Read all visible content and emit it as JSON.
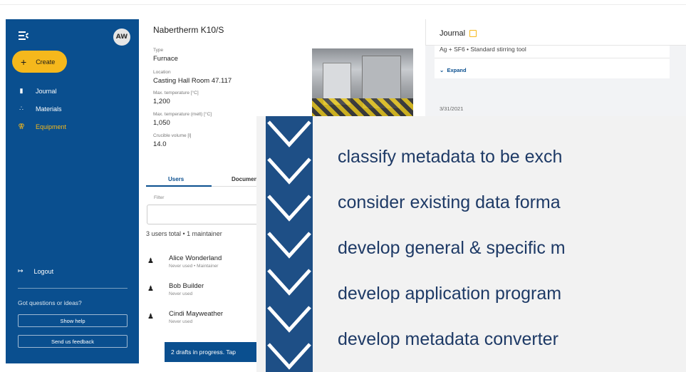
{
  "sidebar": {
    "avatar_initials": "AW",
    "create_label": "Create",
    "nav": [
      {
        "label": "Journal",
        "icon": "book-icon"
      },
      {
        "label": "Materials",
        "icon": "materials-icon"
      },
      {
        "label": "Equipment",
        "icon": "microscope-icon",
        "active": true
      }
    ],
    "logout_label": "Logout",
    "questions_text": "Got questions or ideas?",
    "help_label": "Show help",
    "feedback_label": "Send us feedback"
  },
  "equipment": {
    "title": "Nabertherm K10/S",
    "fields": [
      {
        "label": "Type",
        "value": "Furnace"
      },
      {
        "label": "Location",
        "value": "Casting Hall Room 47.117"
      },
      {
        "label": "Max. temperature [°C]",
        "value": "1,200"
      },
      {
        "label": "Max. temperature (melt) [°C]",
        "value": "1,050"
      },
      {
        "label": "Crucible volume [l]",
        "value": "14.0"
      }
    ],
    "tabs": [
      "Users",
      "Documen"
    ],
    "filter_label": "Filter",
    "users_summary": "3 users total  •  1 maintainer",
    "users": [
      {
        "name": "Alice Wonderland",
        "meta": "Never used • Maintainer"
      },
      {
        "name": "Bob Builder",
        "meta": "Never used"
      },
      {
        "name": "Cindi Mayweather",
        "meta": "Never used"
      }
    ],
    "snackbar": "2 drafts in progress. Tap"
  },
  "journal": {
    "title": "Journal",
    "entry_text": "Ag + SF6  •  Standard stirring tool",
    "expand_label": "Expand",
    "date": "3/31/2021"
  },
  "overlay": {
    "lines": [
      "classify metadata to be exch",
      "consider existing data forma",
      "develop general & specific m",
      "develop application program",
      "develop metadata converter"
    ]
  },
  "colors": {
    "primary": "#0a4f8f",
    "accent": "#f5b81c",
    "overlay_text": "#1e3a66"
  }
}
